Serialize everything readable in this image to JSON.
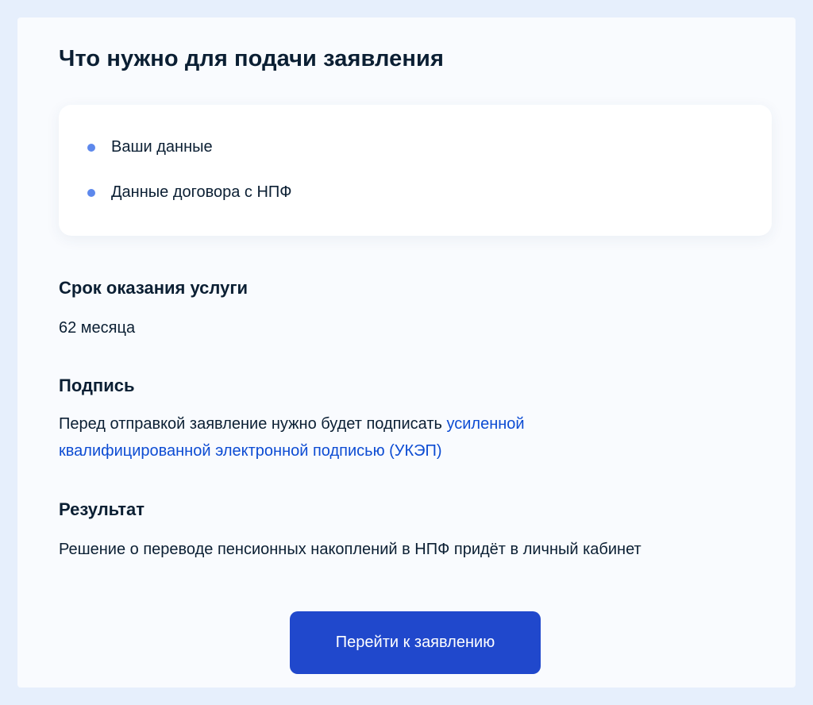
{
  "page": {
    "title": "Что нужно для подачи заявления"
  },
  "requirements": {
    "items": [
      {
        "label": "Ваши данные"
      },
      {
        "label": "Данные договора с НПФ"
      }
    ]
  },
  "service_term": {
    "heading": "Срок оказания услуги",
    "value": "62 месяца"
  },
  "signature": {
    "heading": "Подпись",
    "text_before_link": "Перед отправкой заявление нужно будет подписать ",
    "link_text": "усиленной квалифицированной электронной подписью (УКЭП)"
  },
  "result": {
    "heading": "Результат",
    "text": "Решение о переводе пенсионных накоплений в НПФ придёт в личный кабинет"
  },
  "actions": {
    "primary_label": "Перейти к заявлению"
  },
  "colors": {
    "page_background": "#e6effc",
    "panel_background": "#f9fbfe",
    "text": "#0b1f33",
    "link": "#0d4cd3",
    "bullet": "#5d88ec",
    "primary_button": "#2048cc"
  }
}
